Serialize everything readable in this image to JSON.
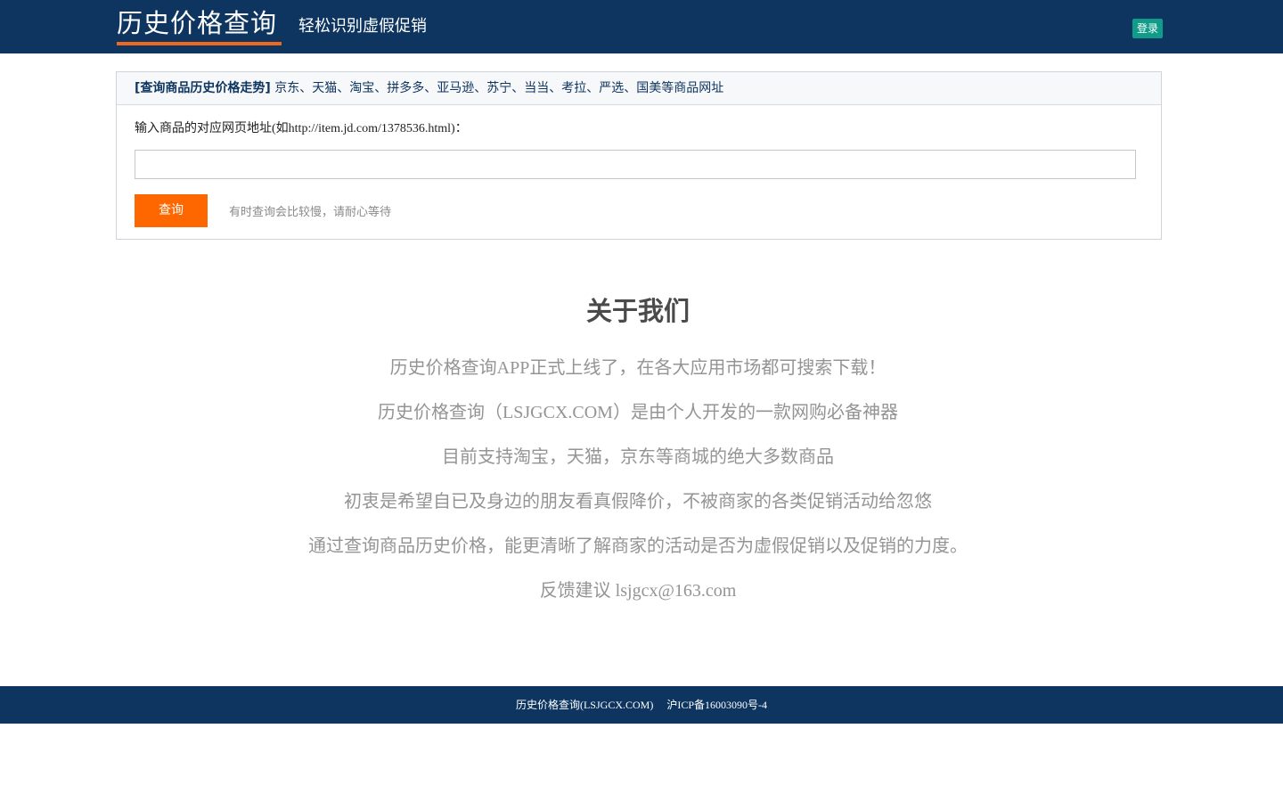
{
  "header": {
    "logo_text": "历史价格查询",
    "tagline": "轻松识别虚假促销",
    "login_label": "登录"
  },
  "colors": {
    "header_bg": "#0e3560",
    "accent_orange": "#fe6600",
    "login_green": "#119c8a"
  },
  "search": {
    "head_title": "[查询商品历史价格走势]",
    "head_sites": " 京东、天猫、淘宝、拼多多、亚马逊、苏宁、当当、考拉、严选、国美等商品网址",
    "url_label": "输入商品的对应网页地址(如http://item.jd.com/1378536.html)：",
    "url_value": "",
    "url_placeholder": "",
    "query_label": "查询",
    "hint": "有时查询会比较慢，请耐心等待"
  },
  "about": {
    "title": "关于我们",
    "lines": [
      "历史价格查询APP正式上线了，在各大应用市场都可搜索下载！",
      "历史价格查询（LSJGCX.COM）是由个人开发的一款网购必备神器",
      "目前支持淘宝，天猫，京东等商城的绝大多数商品",
      "初衷是希望自已及身边的朋友看真假降价，不被商家的各类促销活动给忽悠",
      "通过查询商品历史价格，能更清晰了解商家的活动是否为虚假促销以及促销的力度。",
      "反馈建议 lsjgcx@163.com"
    ]
  },
  "footer": {
    "site_name": "历史价格查询(LSJGCX.COM)",
    "icp": "沪ICP备16003090号-4"
  }
}
